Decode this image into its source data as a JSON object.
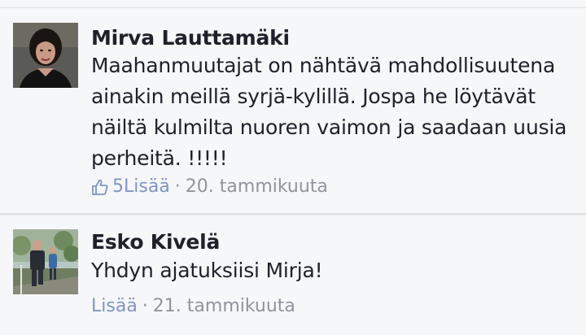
{
  "comments": [
    {
      "author": "Mirva Lauttamäki",
      "text": "Maahanmuutajat on nähtävä mahdollisuutena ainakin meillä syrjä-kylillä. Jospa he löytävät näiltä kulmilta nuoren vaimon ja saadaan uusia perheitä. !!!!!",
      "likes": "5",
      "more_label": "Lisää",
      "separator": "·",
      "date": "20. tammikuuta"
    },
    {
      "author": "Esko Kivelä",
      "text": "Yhdyn ajatuksiisi Mirja!",
      "more_label": "Lisää",
      "separator": "·",
      "date": "21. tammikuuta"
    }
  ],
  "icons": {
    "like": "thumbs-up-icon"
  },
  "colors": {
    "author": "#1d2129",
    "body_text": "#1d2129",
    "meta_text": "#90949c",
    "link": "#7f95c4",
    "background": "#f6f7f9"
  }
}
